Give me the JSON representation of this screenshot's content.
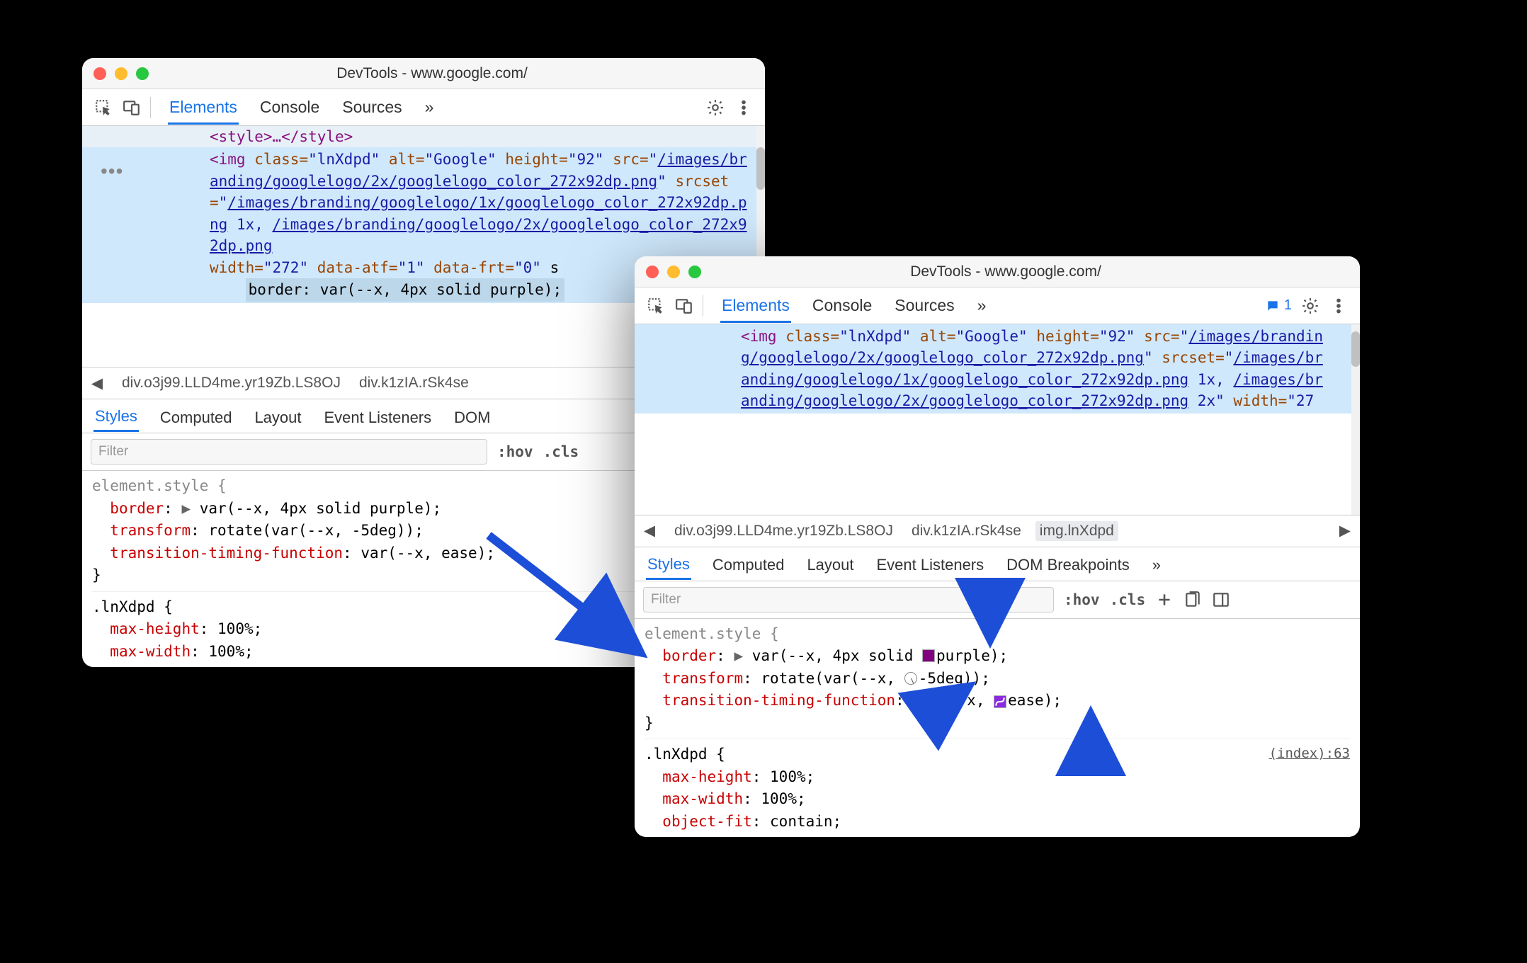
{
  "window_title": "DevTools - www.google.com/",
  "main_tabs": {
    "elements": "Elements",
    "console": "Console",
    "sources": "Sources"
  },
  "subtabs": {
    "styles": "Styles",
    "computed": "Computed",
    "layout": "Layout",
    "listeners": "Event Listeners",
    "dom_bp": "DOM Breakpoints",
    "dom_short": "DOM "
  },
  "filter_placeholder": "Filter",
  "filter_buttons": {
    "hov": ":hov",
    "cls": ".cls"
  },
  "msg_count": "1",
  "crumb": {
    "bc1": "div.o3j99.LLD4me.yr19Zb.LS8OJ",
    "bc2": "div.k1zIA.rSk4se",
    "bc3": "img.lnXdpd"
  },
  "dom_preline": "<style>…</style>",
  "dom_img": {
    "tag_open": "<img",
    "tag_close": ">",
    "class_k": "class",
    "class_v": "\"lnXdpd\"",
    "alt_k": "alt",
    "alt_v": "\"Google\"",
    "height_k": "height",
    "height_v": "\"92\"",
    "src_k": "src",
    "src_v_a": "/images/branding/googlelogo/2x/googlelogo_color_272x92dp.png",
    "srcset_k": "srcset",
    "srcset_v1": "/images/branding/googlelogo/1x/googlelogo_color_272x92dp.png",
    "srcset_1x": " 1x, ",
    "srcset_v2": "/images/branding/googlelogo/2x/googlelogo_color_272x92dp.png",
    "srcset_2x": " 2x",
    "width_k": "width",
    "width_v": "\"272\"",
    "atf_k": "data-atf",
    "atf_v": "\"1\"",
    "frt_k": "data-frt",
    "frt_v": "\"0\"",
    "style_txt_a": "border: var(--x, 4px solid purple);",
    "width_v2": "\"27"
  },
  "css": {
    "elstyle": "element.style {",
    "close": "}",
    "border_p": "border",
    "border_v_plain": "var(--x, 4px solid purple)",
    "border_v_pre": "var(--x, 4px solid ",
    "border_v_color": "purple",
    "border_v_post": ")",
    "transform_p": "transform",
    "transform_v_plain": "rotate(var(--x, -5deg))",
    "transform_v_pre": "rotate(var(--x, ",
    "transform_v_val": "-5deg",
    "transform_v_post": "))",
    "ttf_p": "transition-timing-function",
    "ttf_v_plain": "var(--x, ease)",
    "ttf_v_pre": "var(--x, ",
    "ttf_v_val": "ease",
    "ttf_v_post": ")",
    "sel2": ".lnXdpd {",
    "mh_p": "max-height",
    "mh_v": "100%",
    "mw_p": "max-width",
    "mw_v": "100%",
    "of_p": "object-fit",
    "of_v": "contain",
    "index_link": "(index):63",
    "semicolon": ";",
    "colon": ": ",
    "tri": "▶"
  }
}
